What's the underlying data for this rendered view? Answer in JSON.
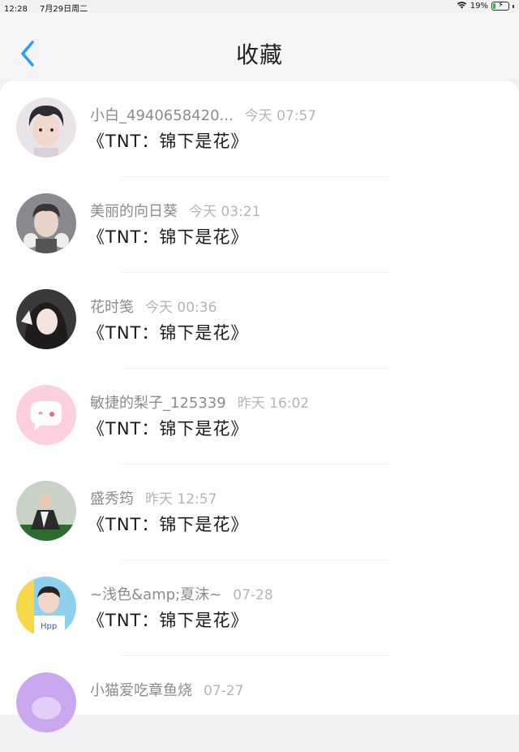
{
  "status_bar": {
    "time": "12:28",
    "date": "7月29日周二",
    "battery": "19%",
    "battery_level": 0.19
  },
  "header": {
    "title": "收藏",
    "back_icon": "chevron-left-icon",
    "accent_color": "#2a9df4"
  },
  "items": [
    {
      "nickname": "小白_4940658420...",
      "time": "今天 07:57",
      "book": "《TNT：锦下是花》"
    },
    {
      "nickname": "美丽的向日葵",
      "time": "今天 03:21",
      "book": "《TNT：锦下是花》"
    },
    {
      "nickname": "花时笺",
      "time": "今天 00:36",
      "book": "《TNT：锦下是花》"
    },
    {
      "nickname": "敏捷的梨子_125339",
      "time": "昨天 16:02",
      "book": "《TNT：锦下是花》"
    },
    {
      "nickname": "盛秀筠",
      "time": "昨天 12:57",
      "book": "《TNT：锦下是花》"
    },
    {
      "nickname": "~浅色&amp;夏沫~",
      "time": "07-28",
      "book": "《TNT：锦下是花》"
    },
    {
      "nickname": "小猫爱吃章鱼烧",
      "time": "07-27",
      "book": ""
    }
  ]
}
